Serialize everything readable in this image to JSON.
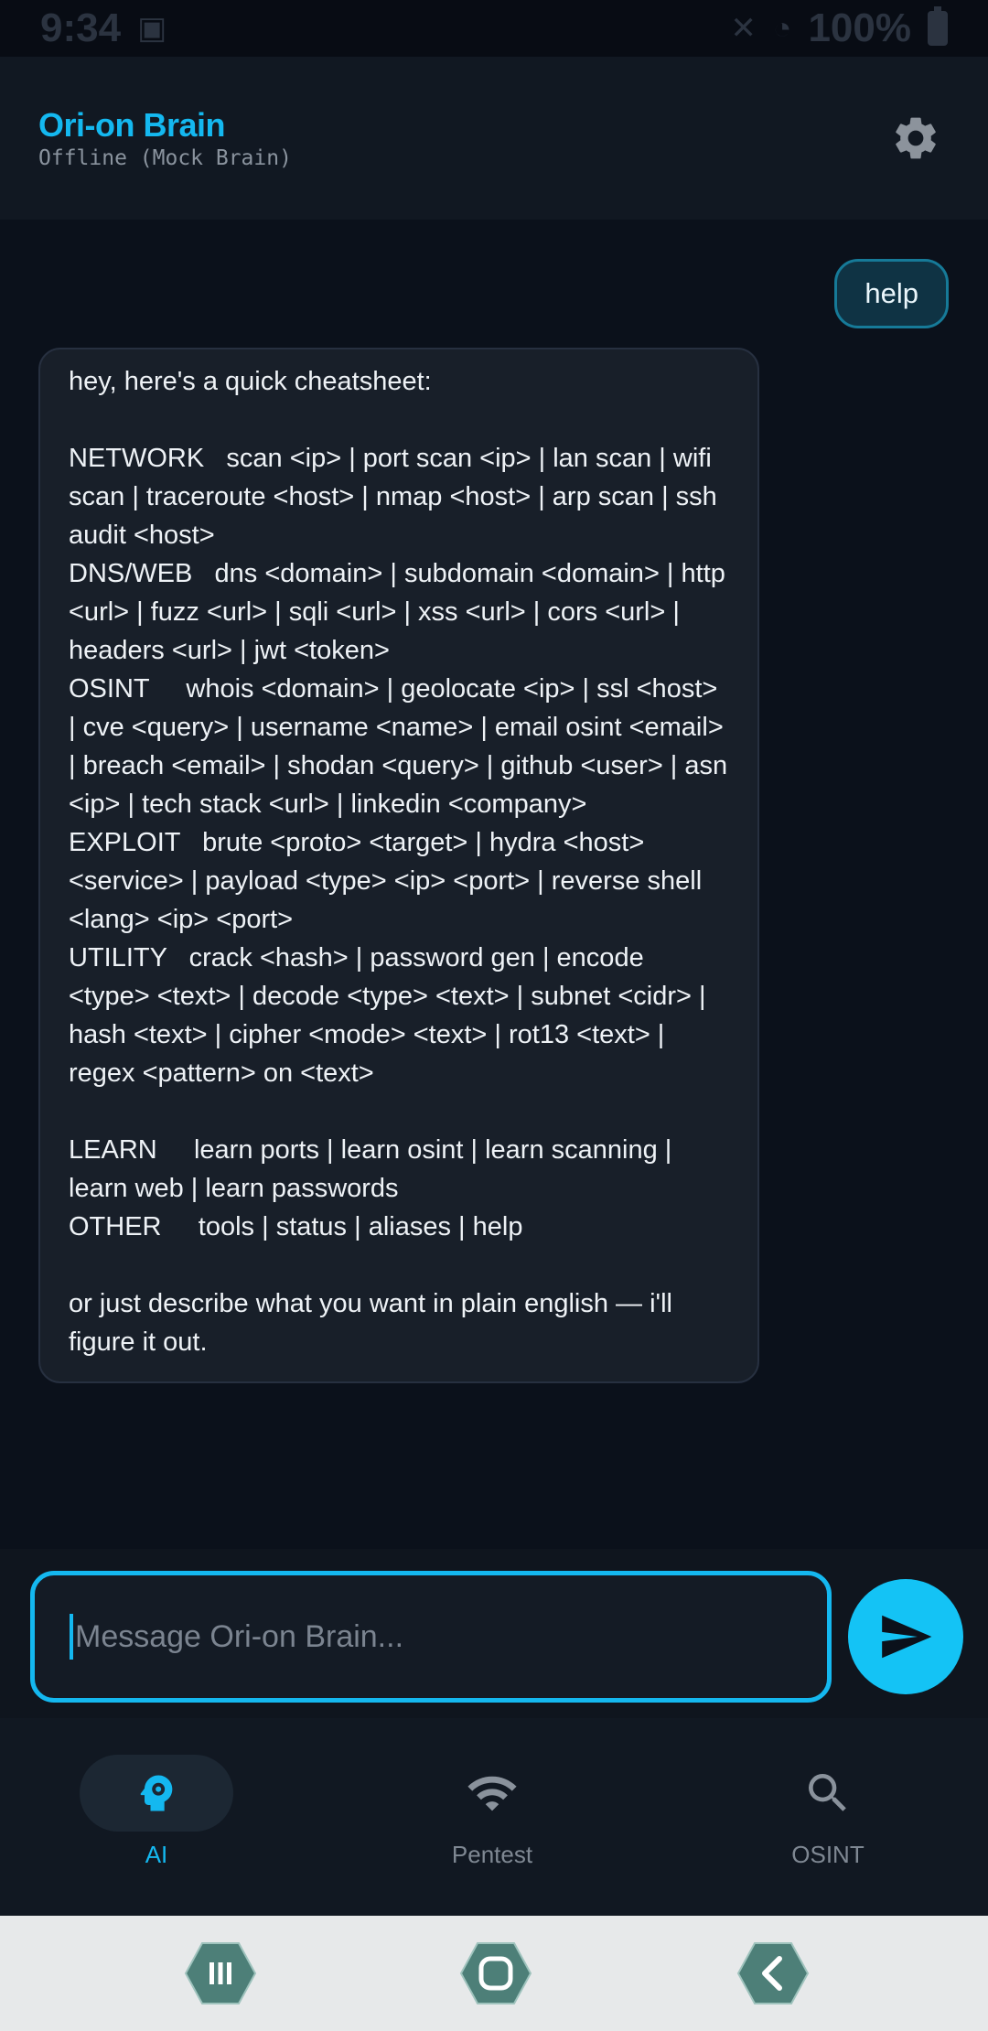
{
  "status_bar": {
    "time": "9:34",
    "battery": "100%"
  },
  "header": {
    "title": "Ori-on Brain",
    "subtitle": "Offline (Mock Brain)",
    "settings_icon": "gear-icon"
  },
  "chat": {
    "user_message": "help",
    "bot_message": "hey, here's a quick cheatsheet:\n\nNETWORK   scan <ip> | port scan <ip> | lan scan | wifi scan | traceroute <host> | nmap <host> | arp scan | ssh audit <host>\nDNS/WEB   dns <domain> | subdomain <domain> | http <url> | fuzz <url> | sqli <url> | xss <url> | cors <url> | headers <url> | jwt <token>\nOSINT     whois <domain> | geolocate <ip> | ssl <host> | cve <query> | username <name> | email osint <email> | breach <email> | shodan <query> | github <user> | asn <ip> | tech stack <url> | linkedin <company>\nEXPLOIT   brute <proto> <target> | hydra <host> <service> | payload <type> <ip> <port> | reverse shell <lang> <ip> <port>\nUTILITY   crack <hash> | password gen | encode <type> <text> | decode <type> <text> | subnet <cidr> | hash <text> | cipher <mode> <text> | rot13 <text> | regex <pattern> on <text>\n\nLEARN     learn ports | learn osint | learn scanning | learn web | learn passwords\nOTHER     tools | status | aliases | help\n\nor just describe what you want in plain english — i'll figure it out."
  },
  "composer": {
    "placeholder": "Message Ori-on Brain...",
    "value": "",
    "send_icon": "send-icon"
  },
  "bottom_nav": {
    "items": [
      {
        "label": "AI",
        "icon": "brain-gear-icon",
        "active": true
      },
      {
        "label": "Pentest",
        "icon": "wifi-icon",
        "active": false
      },
      {
        "label": "OSINT",
        "icon": "search-icon",
        "active": false
      }
    ]
  },
  "system_nav": {
    "recents": "recents-icon",
    "home": "home-icon",
    "back": "back-icon"
  },
  "colors": {
    "accent": "#14b8f0",
    "background": "#0b111b",
    "bubble": "#181f29"
  }
}
